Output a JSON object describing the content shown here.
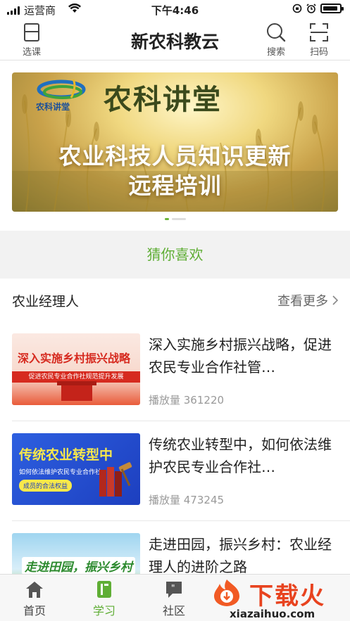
{
  "status_bar": {
    "carrier": "运营商",
    "time": "下午4:46"
  },
  "header": {
    "title": "新农科教云",
    "select_label": "选课",
    "search_label": "搜索",
    "scan_label": "扫码"
  },
  "banner": {
    "logo_text": "农科讲堂",
    "headline": "农科讲堂",
    "line1": "农业科技人员知识更新",
    "line2": "远程培训",
    "page_index": 1,
    "page_count": 2
  },
  "guess_like": "猜你喜欢",
  "section": {
    "title": "农业经理人",
    "more": "查看更多",
    "items": [
      {
        "title": "深入实施乡村振兴战略，促进农民专业合作社管…",
        "plays": "播放量 361220",
        "thumb_title": "深入实施乡村振兴战略",
        "thumb_band": "促进农民专业合作社规范提升发展"
      },
      {
        "title": "传统农业转型中，如何依法维护农民专业合作社…",
        "plays": "播放量 473245",
        "thumb_title": "传统农业转型中",
        "thumb_line": "如何依法维护农民专业合作社",
        "thumb_tag": "成员的合法权益"
      },
      {
        "title": "走进田园，振兴乡村：农业经理人的进阶之路",
        "plays": "",
        "thumb_title": "走进田园，振兴乡村"
      }
    ]
  },
  "tabbar": {
    "items": [
      {
        "label": "首页",
        "icon": "home-icon"
      },
      {
        "label": "学习",
        "icon": "book-icon",
        "active": true
      },
      {
        "label": "社区",
        "icon": "chat-icon"
      }
    ],
    "active_color": "#5fae35"
  },
  "watermark": {
    "brand": "下载火",
    "url": "xiazaihuo.com"
  }
}
